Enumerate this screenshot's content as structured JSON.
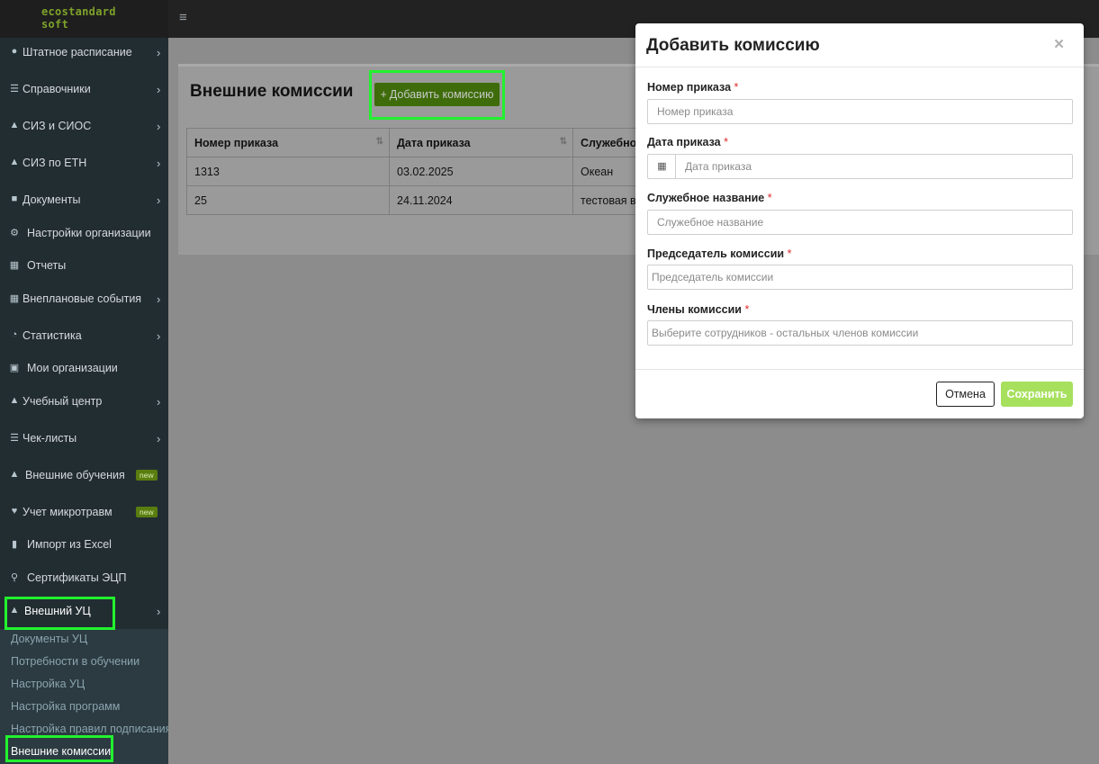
{
  "brand": {
    "line1": "ecostandard",
    "line2": "soft"
  },
  "sidebar": {
    "items": [
      {
        "label": "Штатное расписание",
        "has_arrow": true
      },
      {
        "label": "Справочники",
        "has_arrow": true
      },
      {
        "label": "СИЗ и СИОС",
        "has_arrow": true
      },
      {
        "label": "СИЗ по ЕТН",
        "has_arrow": true
      },
      {
        "label": "Документы",
        "has_arrow": true
      },
      {
        "label": "Настройки организации",
        "has_arrow": false
      },
      {
        "label": "Отчеты",
        "has_arrow": false
      },
      {
        "label": "Внеплановые события",
        "has_arrow": true
      },
      {
        "label": "Статистика",
        "has_arrow": true
      },
      {
        "label": "Мои организации",
        "has_arrow": false
      },
      {
        "label": "Учебный центр",
        "has_arrow": true
      },
      {
        "label": "Чек-листы",
        "has_arrow": true
      },
      {
        "label": "Внешние обучения",
        "badge": "new"
      },
      {
        "label": "Учет микротравм",
        "badge": "new"
      },
      {
        "label": "Импорт из Excel",
        "has_arrow": false
      },
      {
        "label": "Сертификаты ЭЦП",
        "has_arrow": false
      },
      {
        "label": "Внешний УЦ",
        "has_arrow": true
      }
    ],
    "submenu": [
      "Документы УЦ",
      "Потребности в обучении",
      "Настройка УЦ",
      "Настройка программ",
      "Настройка правил подписания",
      "Внешние комиссии"
    ]
  },
  "page": {
    "title": "Внешние комиссии",
    "add_button": "Добавить комиссию"
  },
  "table": {
    "headers": [
      "Номер приказа",
      "Дата приказа",
      "Служебное"
    ],
    "rows": [
      [
        "1313",
        "03.02.2025",
        "Океан"
      ],
      [
        "25",
        "24.11.2024",
        "тестовая вн"
      ]
    ]
  },
  "modal": {
    "title": "Добавить комиссию",
    "close": "×",
    "required_mark": "*",
    "fields": [
      {
        "label": "Номер приказа",
        "placeholder": "Номер приказа"
      },
      {
        "label": "Дата приказа",
        "placeholder": "Дата приказа"
      },
      {
        "label": "Служебное название",
        "placeholder": "Служебное название"
      },
      {
        "label": "Председатель комиссии",
        "placeholder": "Председатель комиссии"
      },
      {
        "label": "Члены комиссии",
        "placeholder": "Выберите сотрудников - остальных членов комиссии"
      }
    ],
    "cancel": "Отмена",
    "save": "Сохранить"
  },
  "colors": {
    "accent_green": "#3e6c0a",
    "save_green": "#a7e05d",
    "highlight": "#22f22e",
    "required": "#dd2c2c"
  }
}
